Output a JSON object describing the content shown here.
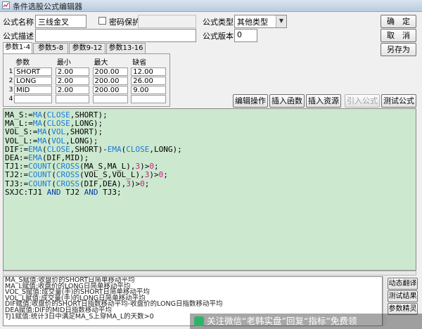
{
  "window": {
    "title": "条件选股公式编辑器"
  },
  "form": {
    "name_label": "公式名称",
    "name_value": "三线金叉",
    "password_label": "密码保护",
    "desc_label": "公式描述",
    "desc_value": "",
    "type_label": "公式类型",
    "type_value": "其他类型",
    "version_label": "公式版本",
    "version_value": "0"
  },
  "buttons": {
    "ok": "确　定",
    "cancel": "取　消",
    "save_as": "另存为",
    "edit_op": "编辑操作",
    "insert_func": "插入函数",
    "insert_res": "插入资源",
    "import_formula": "引入公式",
    "test_formula": "测试公式",
    "dynamic_translate": "动态翻译",
    "test_result": "测试结果",
    "param_guide": "参数精灵"
  },
  "tabs": [
    "参数1-4",
    "参数5-8",
    "参数9-12",
    "参数13-16"
  ],
  "params": {
    "headers": [
      "参数",
      "最小",
      "最大",
      "缺省"
    ],
    "rows": [
      {
        "idx": "1",
        "name": "SHORT",
        "min": "2.00",
        "max": "200.00",
        "def": "12.00"
      },
      {
        "idx": "2",
        "name": "LONG",
        "min": "2.00",
        "max": "200.00",
        "def": "26.00"
      },
      {
        "idx": "3",
        "name": "MID",
        "min": "2.00",
        "max": "200.00",
        "def": "9.00"
      },
      {
        "idx": "4",
        "name": "",
        "min": "",
        "max": "",
        "def": ""
      }
    ]
  },
  "code_lines": [
    "MA_S:=MA(CLOSE,SHORT);",
    "MA_L:=MA(CLOSE,LONG);",
    "VOL_S:=MA(VOL,SHORT);",
    "VOL_L:=MA(VOL,LONG);",
    "DIF:=EMA(CLOSE,SHORT)-EMA(CLOSE,LONG);",
    "DEA:=EMA(DIF,MID);",
    "TJ1:=COUNT(CROSS(MA_S,MA_L),3)>0;",
    "TJ2:=COUNT(CROSS(VOL_S,VOL_L),3)>0;",
    "TJ3:=COUNT(CROSS(DIF,DEA),3)>0;",
    "SXJC:TJ1 AND TJ2 AND TJ3;"
  ],
  "notes": [
    "MA_S赋值:收盘价的SHORT日简单移动平均",
    "MA_L赋值:收盘价的LONG日简单移动平均",
    "VOL_S赋值:成交量(手)的SHORT日简单移动平均",
    "VOL_L赋值:成交量(手)的LONG日简单移动平均",
    "DIF赋值:收盘价的SHORT日指数移动平均-收盘价的LONG日指数移动平均",
    "DEA赋值:DIF的MID日指数移动平均",
    "TJ1赋值:统计3日中满足MA_S上穿MA_L的天数>0"
  ],
  "watermark": {
    "text": "关注微信“老韩实盘”回复“指标”免费领"
  },
  "colors": {
    "editor_bg": "#cce8cf",
    "function": "#1a7bd6",
    "number": "#cc1d84"
  }
}
